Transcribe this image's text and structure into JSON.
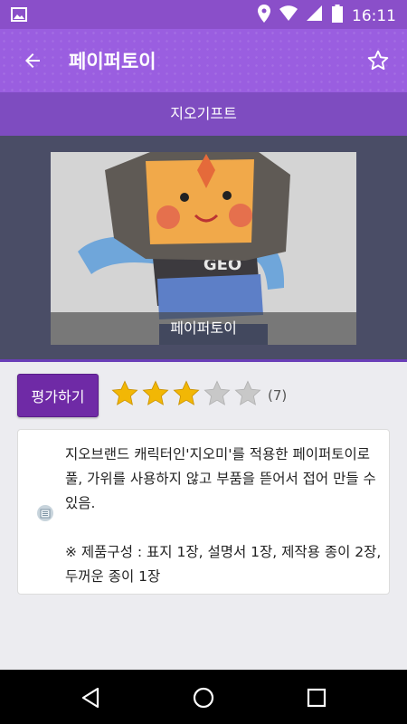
{
  "status_bar": {
    "time": "16:11"
  },
  "app_bar": {
    "title": "페이퍼토이"
  },
  "sub_bar": {
    "label": "지오기프트"
  },
  "hero": {
    "caption": "페이퍼토이",
    "figure_text": "GEO"
  },
  "rating": {
    "button_label": "평가하기",
    "stars_filled": 3,
    "stars_total": 5,
    "count": "(7)"
  },
  "description": {
    "text": "지오브랜드 캐릭터인'지오미'를 적용한 페이퍼토이로 풀, 가위를 사용하지 않고 부품을 뜯어서 접어 만들 수 있음.\n\n※ 제품구성 : 표지 1장, 설명서 1장, 제작용 종이 2장, 두꺼운 종이 1장"
  },
  "colors": {
    "primary": "#9a5ee0",
    "primary_dark": "#7e4cc0",
    "button": "#6f2aa6",
    "star_on": "#f2b705",
    "star_off": "#c8c8c8"
  }
}
